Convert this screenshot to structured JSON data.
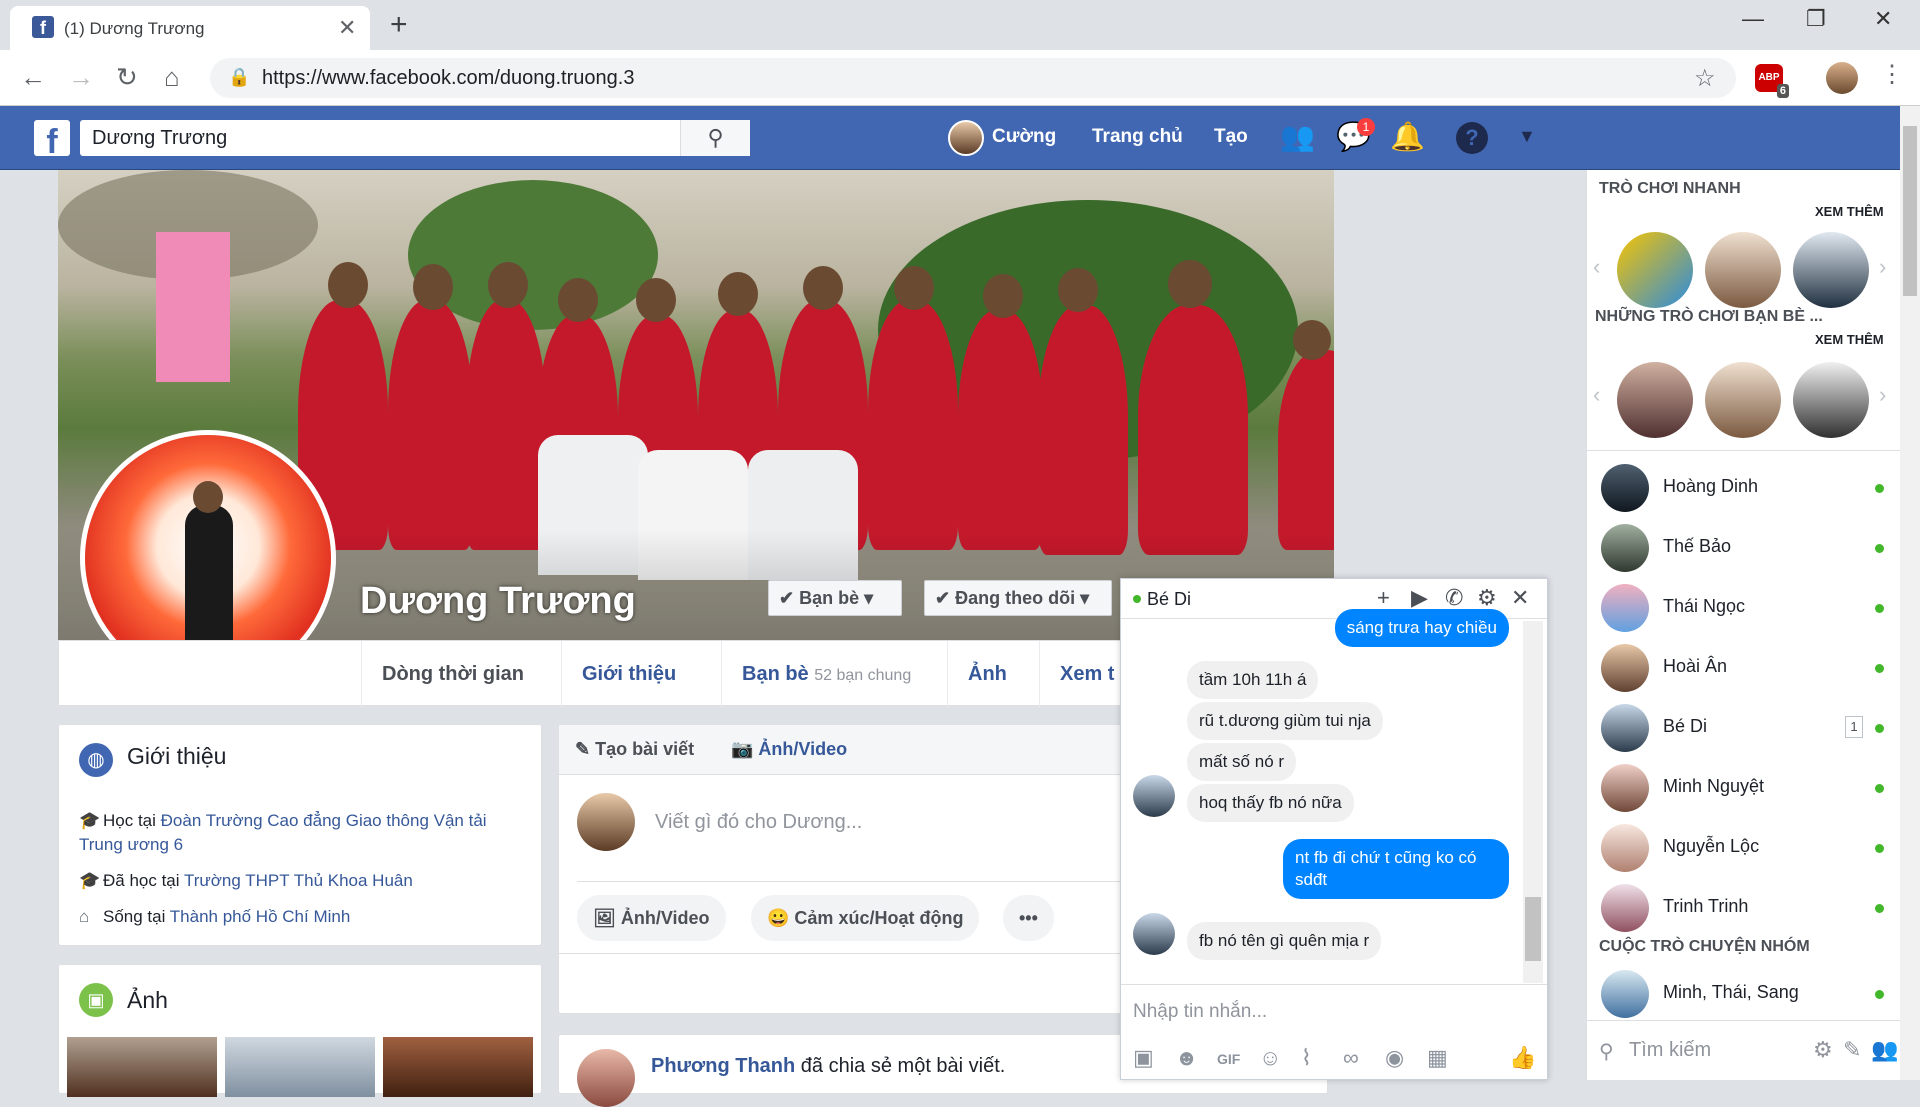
{
  "browser": {
    "tab_title": "(1) Dương Trương",
    "tab_favicon": "f",
    "tab_close": "✕",
    "new_tab": "+",
    "url": "https://www.facebook.com/duong.truong.3",
    "ext_label": "ABP",
    "ext_count": "6",
    "win_min": "—",
    "win_max": "❐",
    "win_close": "✕"
  },
  "fb_header": {
    "logo": "f",
    "search_value": "Dương Trương",
    "user_name": "Cường",
    "home": "Trang chủ",
    "create": "Tạo",
    "messages_badge": "1",
    "brand_color": "#4267b2"
  },
  "profile": {
    "name": "Dương Trương",
    "friends_button": "Bạn bè",
    "following_button": "Đang theo dõi",
    "tabs": {
      "timeline": "Dòng thời gian",
      "about": "Giới thiệu",
      "friends": "Bạn bè",
      "friends_sub": "52 bạn chung",
      "photos": "Ảnh",
      "more": "Xem t"
    }
  },
  "intro": {
    "title": "Giới thiệu",
    "lines": [
      {
        "prefix": "Học tại ",
        "link": "Đoàn Trường Cao đẳng Giao thông Vận tải Trung ương 6"
      },
      {
        "prefix": "Đã học tại ",
        "link": "Trường THPT Thủ Khoa Huân"
      },
      {
        "prefix": "Sống tại ",
        "link": "Thành phố Hồ Chí Minh"
      }
    ]
  },
  "photos_card": {
    "title": "Ảnh"
  },
  "composer": {
    "create_post": "Tạo bài viết",
    "photo_video_tab": "Ảnh/Video",
    "placeholder": "Viết gì đó cho Dương...",
    "photo_video": "Ảnh/Video",
    "feeling": "Cảm xúc/Hoạt động",
    "more": "•••"
  },
  "feed_post": {
    "author": "Phương Thanh",
    "text": " đã chia sẻ một bài viết."
  },
  "chat": {
    "name": "Bé Di",
    "messages": [
      {
        "from": "me",
        "text": "sáng trưa hay chiều"
      },
      {
        "from": "them",
        "text": "tầm 10h 11h á"
      },
      {
        "from": "them",
        "text": "rũ t.dương giùm tui nja"
      },
      {
        "from": "them",
        "text": "mất số nó r"
      },
      {
        "from": "them",
        "text": "hoq thấy fb nó nữa"
      },
      {
        "from": "me",
        "text": "nt fb đi chứ t cũng ko có sdđt"
      },
      {
        "from": "them",
        "text": "fb nó tên gì quên mịa r"
      }
    ],
    "input_placeholder": "Nhập tin nhắn..."
  },
  "sidebar": {
    "quick_games": "TRÒ CHƠI NHANH",
    "see_more": "XEM THÊM",
    "friends_games": "NHỮNG TRÒ CHƠI BẠN BÈ ...",
    "contacts": [
      {
        "name": "Hoàng Dinh",
        "badge": ""
      },
      {
        "name": "Thế Bảo",
        "badge": ""
      },
      {
        "name": "Thái Ngọc",
        "badge": ""
      },
      {
        "name": "Hoài Ân",
        "badge": ""
      },
      {
        "name": "Bé Di",
        "badge": "1"
      },
      {
        "name": "Minh Nguyệt",
        "badge": ""
      },
      {
        "name": "Nguyễn Lộc",
        "badge": ""
      },
      {
        "name": "Trinh Trinh",
        "badge": ""
      }
    ],
    "group_heading": "CUỘC TRÒ CHUYỆN NHÓM",
    "group": {
      "name": "Minh, Thái, Sang"
    },
    "search_placeholder": "Tìm kiếm"
  }
}
